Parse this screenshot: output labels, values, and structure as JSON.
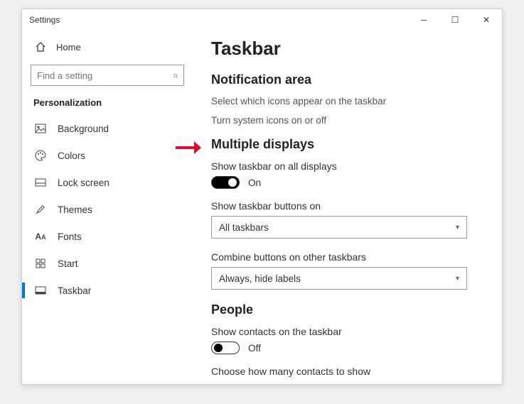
{
  "window": {
    "title": "Settings"
  },
  "sidebar": {
    "home": "Home",
    "search_placeholder": "Find a setting",
    "category": "Personalization",
    "items": [
      {
        "label": "Background"
      },
      {
        "label": "Colors"
      },
      {
        "label": "Lock screen"
      },
      {
        "label": "Themes"
      },
      {
        "label": "Fonts"
      },
      {
        "label": "Start"
      },
      {
        "label": "Taskbar"
      }
    ]
  },
  "main": {
    "title": "Taskbar",
    "notification": {
      "heading": "Notification area",
      "link_icons": "Select which icons appear on the taskbar",
      "link_system": "Turn system icons on or off"
    },
    "multiple_displays": {
      "heading": "Multiple displays",
      "show_all_label": "Show taskbar on all displays",
      "show_all_state": "On",
      "buttons_on_label": "Show taskbar buttons on",
      "buttons_on_value": "All taskbars",
      "combine_label": "Combine buttons on other taskbars",
      "combine_value": "Always, hide labels"
    },
    "people": {
      "heading": "People",
      "show_contacts_label": "Show contacts on the taskbar",
      "show_contacts_state": "Off",
      "choose_label": "Choose how many contacts to show"
    }
  }
}
